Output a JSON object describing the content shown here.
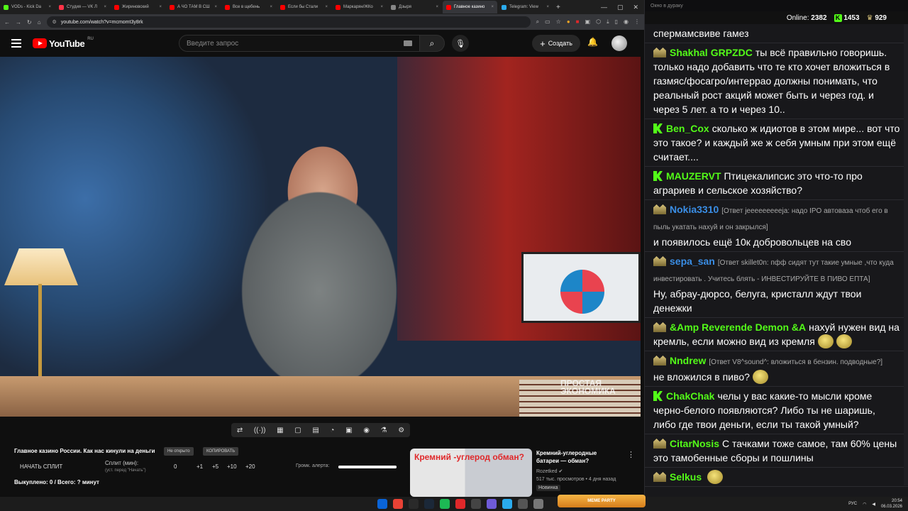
{
  "browser": {
    "tabs": [
      {
        "label": "VODs - Kick Da",
        "color": "#53fc18"
      },
      {
        "label": "Студия — VK Л",
        "color": "#ff3347"
      },
      {
        "label": "Жириновский",
        "color": "#ff0000"
      },
      {
        "label": "А ЧО ТАМ В СШ",
        "color": "#ff0000"
      },
      {
        "label": "Все в щебень",
        "color": "#ff0000"
      },
      {
        "label": "Если бы Стали",
        "color": "#ff0000"
      },
      {
        "label": "Маркарян/ЖКо",
        "color": "#ff0000"
      },
      {
        "label": "Дзыря",
        "color": "#888888"
      },
      {
        "label": "Главное казино",
        "color": "#ff0000",
        "active": true
      },
      {
        "label": "Telegram: View",
        "color": "#2aabee"
      }
    ],
    "new_tab": "+",
    "url": "youtube.com/watch?v=mcmomt3y8rk"
  },
  "youtube": {
    "logo_text": "YouTube",
    "region": "RU",
    "search_placeholder": "Введите запрос",
    "create_label": "Создать",
    "video_watermark": "ПРОСТАЯ ЭКОНОМИКА",
    "tools": [
      "⇄",
      "((·))",
      "▦",
      "▢",
      "▤",
      "◔",
      "▣",
      "◉",
      "⚗",
      "⚙"
    ],
    "title": "Главное казино России. Как нас кинули на деньги",
    "pill1": "Не открыто",
    "pill2": "КОПИРОВАТЬ",
    "split_button": "НАЧАТЬ СПЛИТ",
    "split_label": "Сплит (мин):",
    "split_sub": "(уст. перед \"Начать\")",
    "split_values": [
      "0",
      "+1",
      "+5",
      "+10",
      "+20"
    ],
    "volume_label": "Громк. алерта:",
    "volume_level": 1.0,
    "bought": "Выкуплено: 0 / Всего: ? минут",
    "rec": {
      "thumb_text": "Кремний -углерод обман?",
      "title": "Кремний-углеродные батареи — обман?",
      "channel": "Rozetked",
      "meta": "517 тыс. просмотров • 4 дня назад",
      "badge": "Новинка"
    }
  },
  "chat": {
    "top": "Окно в дураку",
    "online_label": "Online:",
    "online": "2382",
    "kick_count": "1453",
    "crown_count": "929",
    "messages": [
      {
        "user": "",
        "color": "#53fc18",
        "badge": "none",
        "reply": "",
        "text": "спермамсвиве гамез"
      },
      {
        "user": "Shakhal",
        "user2": "GRPZDC",
        "color": "#53fc18",
        "badge": "crown",
        "reply": "",
        "text": "ты всё правильно говоришь. только надо добавить что те кто хочет вложиться в газмяс/фосагро/интеррао должны понимать, что реальный рост акций может быть и через год. и через 5 лет. а то и через 10.."
      },
      {
        "user": "Ben_Cox",
        "color": "#53fc18",
        "badge": "kick",
        "reply": "",
        "text": "сколько ж идиотов в этом мире... вот что это такое? и каждый же ж себя умным при этом ещё считает...."
      },
      {
        "user": "MAUZERVT",
        "color": "#53fc18",
        "badge": "kick",
        "reply": "",
        "text": "Птицекалипсис это что-то про аграриев и сельское хозяйство?"
      },
      {
        "user": "Nokia3310",
        "color": "#3a8ee6",
        "badge": "crown",
        "reply": "[Ответ jeeeeeeeeeja: надо IPO автоваза чтоб его в пыль укатать нахуй и он закрылся]",
        "text": "и появилось ещё 10к добровольцев на сво"
      },
      {
        "user": "sepa_san",
        "color": "#3a8ee6",
        "badge": "crown",
        "reply": "[Ответ skillet0n: пфф сидят тут такие умные ,что куда инвестировать . Учитесь блять - ИНВЕСТИРУЙТЕ В ПИВО ЕПТА]",
        "text": "Ну, абрау-дюрсо, белуга, кристалл ждут твои денежки"
      },
      {
        "user": "&Amp Reverende Demon &A",
        "color": "#53fc18",
        "badge": "crown",
        "reply": "",
        "text": "нахуй нужен вид на кремль, если можно вид из кремля",
        "emotes": 2
      },
      {
        "user": "Nndrew",
        "color": "#53fc18",
        "badge": "crown",
        "reply": "[Ответ V8^sound^: вложиться в бензин. подводные?]",
        "text": "не вложился в пиво?",
        "emotes": 1
      },
      {
        "user": "ChakChak",
        "color": "#53fc18",
        "badge": "kick",
        "reply": "",
        "text": "челы у вас какие-то мысли кроме черно-белого появляются? Либо ты не шаришь, либо где твои деньги, если ты такой умный?"
      },
      {
        "user": "CitarNosis",
        "color": "#53fc18",
        "badge": "crown",
        "reply": "",
        "text": "С тачками тоже самое, там 60% цены это тамобенные сборы и пошлины"
      },
      {
        "user": "Selkus",
        "color": "#53fc18",
        "badge": "crown",
        "reply": "",
        "text": "",
        "emotes": 1
      }
    ]
  },
  "taskbar": {
    "meme_label": "MEME PARTY",
    "lang": "РУС",
    "time": "20:54",
    "date": "06.03.2026",
    "icon_colors": [
      "#0a64d8",
      "#e94235",
      "#2a2a2a",
      "#1b2838",
      "#1db954",
      "#e0282a",
      "#444",
      "#6f5bd8",
      "#2aabee",
      "#555",
      "#777"
    ]
  }
}
